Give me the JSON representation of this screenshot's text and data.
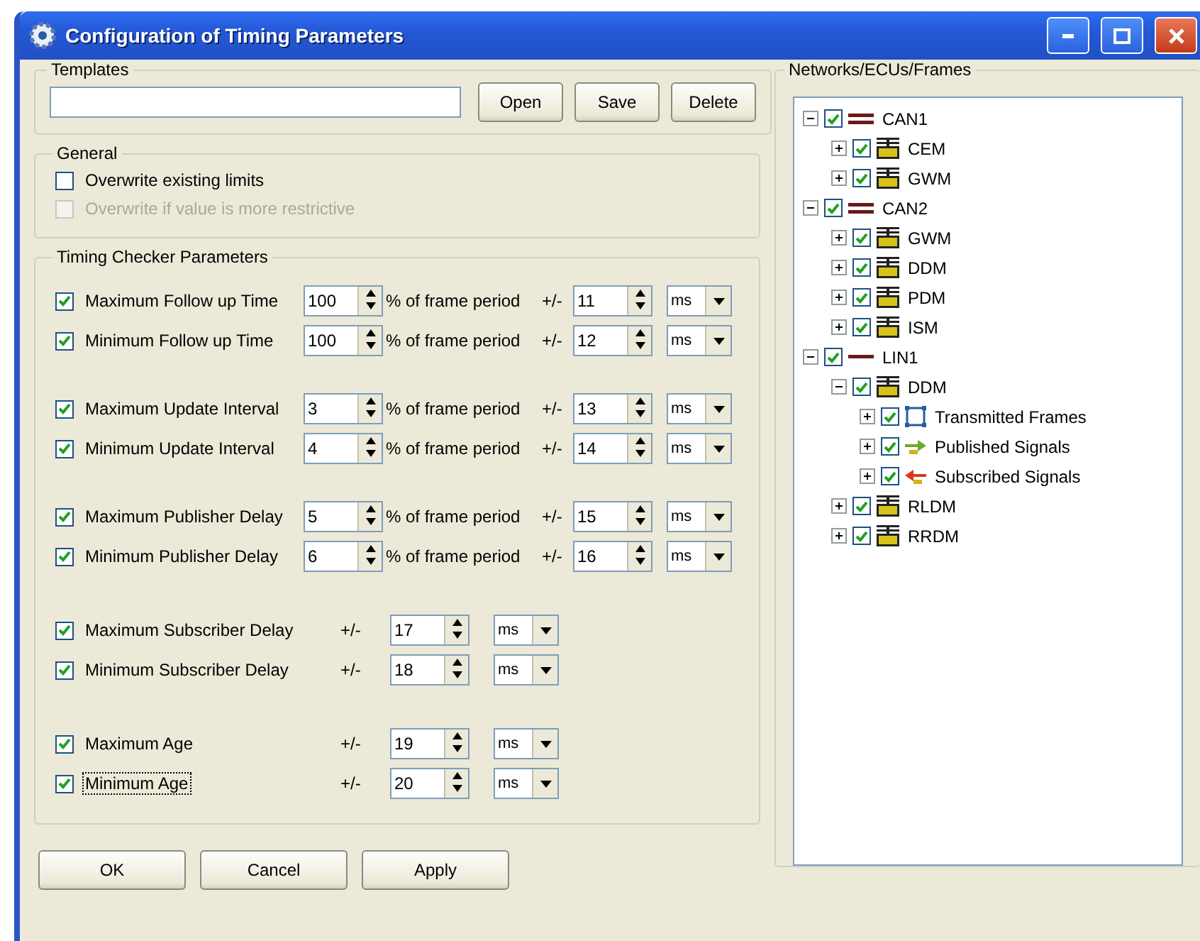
{
  "window": {
    "title": "Configuration of Timing Parameters"
  },
  "templates": {
    "label": "Templates",
    "buttons": [
      "Open",
      "Save",
      "Delete"
    ]
  },
  "general": {
    "label": "General",
    "options": [
      {
        "label": "Overwrite existing limits",
        "checked": false,
        "disabled": false
      },
      {
        "label": "Overwrite if value is more restrictive",
        "checked": false,
        "disabled": true
      }
    ]
  },
  "timing": {
    "label": "Timing Checker  Parameters",
    "groups": [
      {
        "rows": [
          {
            "kind": "percent",
            "label": "Maximum Follow up Time",
            "checked": true,
            "focused": false,
            "percent": "100",
            "period_text": "% of frame period",
            "plusminus": "+/-",
            "tolerance": "11",
            "unit": "ms"
          },
          {
            "kind": "percent",
            "label": "Minimum Follow up Time",
            "checked": true,
            "focused": false,
            "percent": "100",
            "period_text": "% of frame period",
            "plusminus": "+/-",
            "tolerance": "12",
            "unit": "ms"
          }
        ]
      },
      {
        "rows": [
          {
            "kind": "percent",
            "label": "Maximum Update Interval",
            "checked": true,
            "focused": false,
            "percent": "3",
            "period_text": "% of frame period",
            "plusminus": "+/-",
            "tolerance": "13",
            "unit": "ms"
          },
          {
            "kind": "percent",
            "label": "Minimum Update Interval",
            "checked": true,
            "focused": false,
            "percent": "4",
            "period_text": "% of frame period",
            "plusminus": "+/-",
            "tolerance": "14",
            "unit": "ms"
          }
        ]
      },
      {
        "rows": [
          {
            "kind": "percent",
            "label": "Maximum Publisher Delay",
            "checked": true,
            "focused": false,
            "percent": "5",
            "period_text": "% of frame period",
            "plusminus": "+/-",
            "tolerance": "15",
            "unit": "ms"
          },
          {
            "kind": "percent",
            "label": "Minimum Publisher Delay",
            "checked": true,
            "focused": false,
            "percent": "6",
            "period_text": "% of frame period",
            "plusminus": "+/-",
            "tolerance": "16",
            "unit": "ms"
          }
        ]
      },
      {
        "rows": [
          {
            "kind": "simple",
            "label": "Maximum Subscriber Delay",
            "checked": true,
            "focused": false,
            "plusminus": "+/-",
            "tolerance": "17",
            "unit": "ms"
          },
          {
            "kind": "simple",
            "label": "Minimum Subscriber Delay",
            "checked": true,
            "focused": false,
            "plusminus": "+/-",
            "tolerance": "18",
            "unit": "ms"
          }
        ]
      },
      {
        "rows": [
          {
            "kind": "simple",
            "label": "Maximum Age",
            "checked": true,
            "focused": false,
            "plusminus": "+/-",
            "tolerance": "19",
            "unit": "ms"
          },
          {
            "kind": "simple",
            "label": "Minimum Age",
            "checked": true,
            "focused": true,
            "plusminus": "+/-",
            "tolerance": "20",
            "unit": "ms"
          }
        ]
      }
    ]
  },
  "networks": {
    "label": "Networks/ECUs/Frames",
    "tree": [
      {
        "kind": "can",
        "label": "CAN1",
        "checked": true,
        "expanded": true,
        "children": [
          {
            "kind": "ecu",
            "label": "CEM",
            "checked": true,
            "expanded": false
          },
          {
            "kind": "ecu",
            "label": "GWM",
            "checked": true,
            "expanded": false
          }
        ]
      },
      {
        "kind": "can",
        "label": "CAN2",
        "checked": true,
        "expanded": true,
        "children": [
          {
            "kind": "ecu",
            "label": "GWM",
            "checked": true,
            "expanded": false
          },
          {
            "kind": "ecu",
            "label": "DDM",
            "checked": true,
            "expanded": false
          },
          {
            "kind": "ecu",
            "label": "PDM",
            "checked": true,
            "expanded": false
          },
          {
            "kind": "ecu",
            "label": "ISM",
            "checked": true,
            "expanded": false
          }
        ]
      },
      {
        "kind": "lin",
        "label": "LIN1",
        "checked": true,
        "expanded": true,
        "children": [
          {
            "kind": "ecu",
            "label": "DDM",
            "checked": true,
            "expanded": true,
            "children": [
              {
                "kind": "frames",
                "label": "Transmitted Frames",
                "checked": true,
                "expanded": false
              },
              {
                "kind": "published",
                "label": "Published Signals",
                "checked": true,
                "expanded": false
              },
              {
                "kind": "subscribed",
                "label": "Subscribed Signals",
                "checked": true,
                "expanded": false
              }
            ]
          },
          {
            "kind": "ecu",
            "label": "RLDM",
            "checked": true,
            "expanded": false
          },
          {
            "kind": "ecu",
            "label": "RRDM",
            "checked": true,
            "expanded": false
          }
        ]
      }
    ]
  },
  "buttons": [
    "OK",
    "Cancel",
    "Apply"
  ]
}
